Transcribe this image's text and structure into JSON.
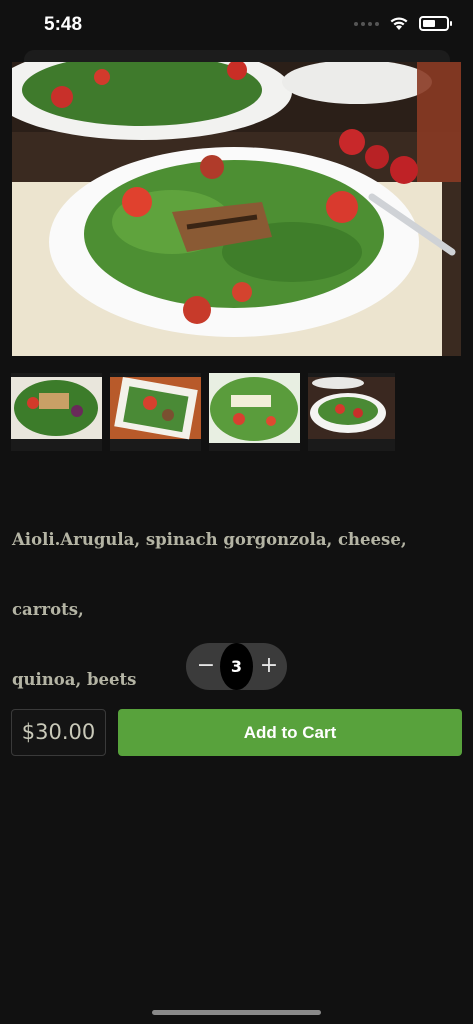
{
  "status_bar": {
    "time": "5:48",
    "battery_level": 0.55
  },
  "product": {
    "hero_image_icon": "salad-photo",
    "thumbnail_icons": [
      "salad-thumb-1",
      "salad-thumb-2",
      "salad-thumb-3",
      "salad-thumb-4"
    ],
    "description_line1": "Aioli.Arugula, spinach gorgonzola, cheese, carrots,",
    "description_line2": "quinoa, beets"
  },
  "quantity": {
    "minus": "−",
    "value": "3",
    "plus": "+"
  },
  "price": "$30.00",
  "cart_button_label": "Add to Cart",
  "colors": {
    "background": "#111111",
    "accent": "#58a23c",
    "quantity_pill": "#3b3b3b",
    "description": "#b4b4a4"
  }
}
